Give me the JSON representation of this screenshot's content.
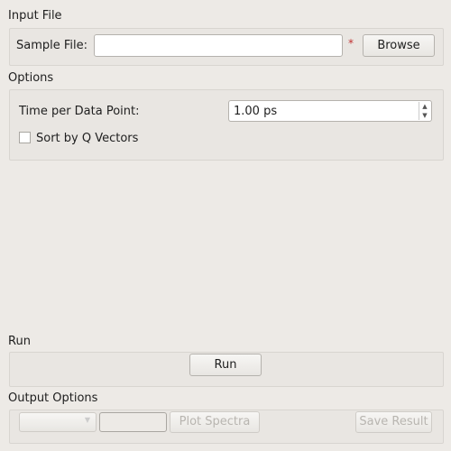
{
  "input_file": {
    "title": "Input File",
    "sample_label": "Sample File:",
    "sample_value": "",
    "required_marker": "*",
    "browse": "Browse"
  },
  "options": {
    "title": "Options",
    "time_label": "Time per Data Point:",
    "time_value": "1.00 ps",
    "sort_label": "Sort by Q Vectors",
    "sort_checked": false
  },
  "run": {
    "title": "Run",
    "run_button": "Run"
  },
  "output": {
    "title": "Output Options",
    "plot": "Plot Spectra",
    "save": "Save Result"
  }
}
